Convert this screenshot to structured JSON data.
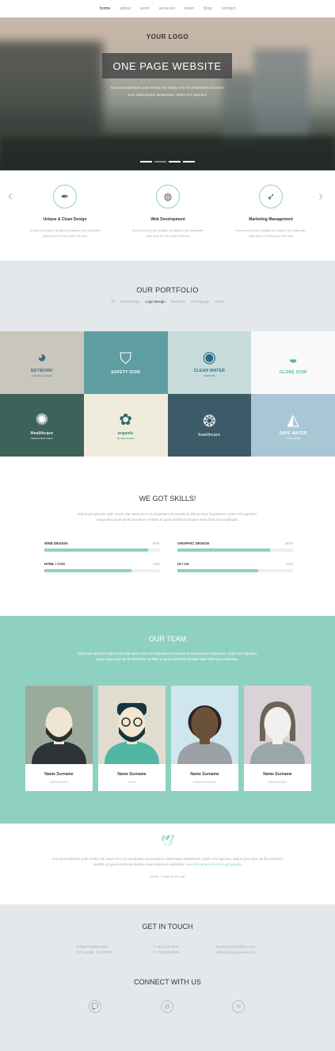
{
  "nav": {
    "items": [
      "home",
      "about",
      "work",
      "services",
      "team",
      "blog",
      "contact"
    ]
  },
  "hero": {
    "logo": "YOUR LOGO",
    "title": "ONE PAGE WEBSITE",
    "subtitle_line1": "Sed ut perspiciatis unde omnis iste natus error sit voluptatem accusan-",
    "subtitle_line2": "tium doloremque laudantium, totam rem aperiam"
  },
  "services": [
    {
      "icon": "pen-icon",
      "glyph": "✒",
      "title": "Unique & Clean Design",
      "desc1": "Donec pede justo fringilla vel aliquet nec vulputate",
      "desc2": "eget arcu in enim justo rhoncus"
    },
    {
      "icon": "globe-icon",
      "glyph": "◍",
      "title": "Web Development",
      "desc1": "Donec pede justo fringilla vel aliquet nec vulputate",
      "desc2": "eget arcu in enim justo rhoncus"
    },
    {
      "icon": "rocket-icon",
      "glyph": "➶",
      "title": "Marketing Management",
      "desc1": "Donec pede justo fringilla vel aliquet nec vulputate",
      "desc2": "eget arcu in enim justo rhoncus"
    }
  ],
  "portfolio": {
    "title": "OUR PORTFOLIO",
    "filters": [
      "All",
      "Web Design",
      "Logo Design",
      "Illustrator",
      "Photograph",
      "Video"
    ],
    "active_filter": "Logo Design",
    "tiles": [
      {
        "name": "NETWORK",
        "sub": "marketing & design",
        "bg": "#c9c6bc",
        "fg": "#3f6b79",
        "glyph": "◕"
      },
      {
        "name": "SAFETY ICON",
        "sub": "",
        "bg": "#5e9ea2",
        "fg": "#ffffff",
        "glyph": "⛉"
      },
      {
        "name": "CLEAN WATER",
        "sub": "healthy life",
        "bg": "#c8dcdb",
        "fg": "#2e6a80",
        "glyph": "◉"
      },
      {
        "name": "GLOBE ICON",
        "sub": "",
        "bg": "#f9f9f9",
        "fg": "#5bb3a1",
        "glyph": "◒"
      },
      {
        "name": "Healthcare",
        "sub": "Medical Clinic Name",
        "bg": "#3d625a",
        "fg": "#ffffff",
        "glyph": "✺"
      },
      {
        "name": "organic",
        "sub": "Friendly Product",
        "bg": "#f0ecdc",
        "fg": "#2e6e6a",
        "glyph": "✿"
      },
      {
        "name": "healthcare",
        "sub": "",
        "bg": "#3d5a68",
        "fg": "#dfe8e8",
        "glyph": "❂"
      },
      {
        "name": "SAVE WATER",
        "sub": "SAVE EARTH",
        "bg": "#a8c6d3",
        "fg": "#ffffff",
        "glyph": "◭"
      }
    ]
  },
  "skills": {
    "title": "WE GOT SKILLS!",
    "desc1": "Sed ut perspiciatis unde omnis iste natus error sit voluptatem accusantium doloremque laudantium, totam rem aperiam,",
    "desc2": "eaque ipsa quae ab illo inventore veritatis et quasi architecto beatae vitae dicta sunt explicabo.",
    "items": [
      {
        "label": "WEB DESIGN",
        "value": 90,
        "text": "90%"
      },
      {
        "label": "GRAPHIC DESIGN",
        "value": 80,
        "text": "80%"
      },
      {
        "label": "HTML / CSS",
        "value": 75,
        "text": "75%"
      },
      {
        "label": "UI / UX",
        "value": 70,
        "text": "70%"
      }
    ]
  },
  "team": {
    "title": "OUR TEAM",
    "desc1": "Sed ut perspiciatis unde omnis iste natus error sit voluptatem accusantium doloremque laudantium, totam rem aperiam,",
    "desc2": "eaque ipsa quae ab illo inventore veritatis et quasi architecto beatae vitae dicta sunt explicabo.",
    "members": [
      {
        "name": "Name Surname",
        "role": "DESIGNER",
        "bg": "#9aab9b",
        "skin": "#eee6d2",
        "hair": "#2d2d2d",
        "shirt": "#2d3336"
      },
      {
        "name": "Name Surname",
        "role": "SEO",
        "bg": "#e0ddd0",
        "skin": "#f5e6cf",
        "hair": "#16333e",
        "shirt": "#4fb7a4"
      },
      {
        "name": "Name Surname",
        "role": "PROGRAMER",
        "bg": "#cfe6ee",
        "skin": "#6c5139",
        "hair": "#2b2520",
        "shirt": "#9aa0a4"
      },
      {
        "name": "Name Surname",
        "role": "MANAGER",
        "bg": "#d9d2d6",
        "skin": "#f1f0ee",
        "hair": "#6b6355",
        "shirt": "#9aa7a9"
      }
    ]
  },
  "twitter": {
    "icon": "bird-icon",
    "line1": "Sed ut perspiciatis unde omnis iste natus error sit voluptatem accusantium doloremque laudantium, totam rem aperiam, eaque ipsa quae ab illo inventore",
    "line2_text": "veritatis et quasi architecto beatae vitae dicta sunt explicabo.",
    "line2_link": "www.sitename.net/sed-ut-perspiciatis",
    "time": "Ahmet, 9 days 30 min ago"
  },
  "contact": {
    "title": "GET IN TOUCH",
    "address1": "STREET NAME 1024",
    "address2": "CITY NAME, COUNTRY",
    "phone1": "T: +00 1234 5678",
    "phone2": "F: +00 2345 6789",
    "email1": "fernas.ninefor@office.com",
    "email2": "office@companyname.com",
    "connect_title": "CONNECT WITH US",
    "social": [
      "chat-icon",
      "email-at-icon",
      "mail-icon"
    ]
  },
  "colors": {
    "accent": "#8fd1c0",
    "grey_bg": "#e5e8ea"
  }
}
